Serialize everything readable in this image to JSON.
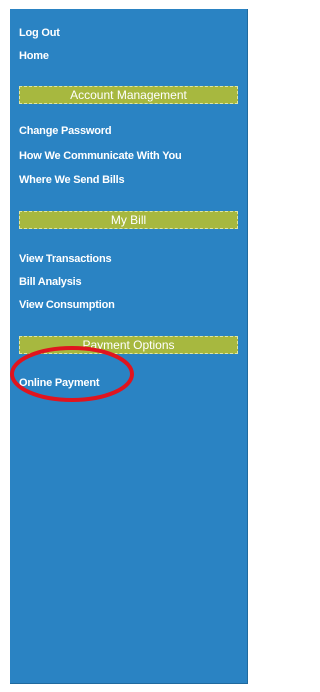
{
  "top_links": [
    {
      "label": "Log Out"
    },
    {
      "label": "Home"
    }
  ],
  "sections": [
    {
      "title": "Account Management",
      "items": [
        {
          "label": "Change Password"
        },
        {
          "label": "How We Communicate With You"
        },
        {
          "label": "Where We Send Bills"
        }
      ]
    },
    {
      "title": "My Bill",
      "items": [
        {
          "label": "View Transactions"
        },
        {
          "label": "Bill Analysis"
        },
        {
          "label": "View Consumption"
        }
      ]
    },
    {
      "title": "Payment Options",
      "items": [
        {
          "label": "Online Payment"
        }
      ]
    }
  ],
  "colors": {
    "sidebar_background": "#2a83c3",
    "section_header_background": "#a7b83f",
    "highlight_ring": "#e0141e",
    "text": "#ffffff"
  }
}
